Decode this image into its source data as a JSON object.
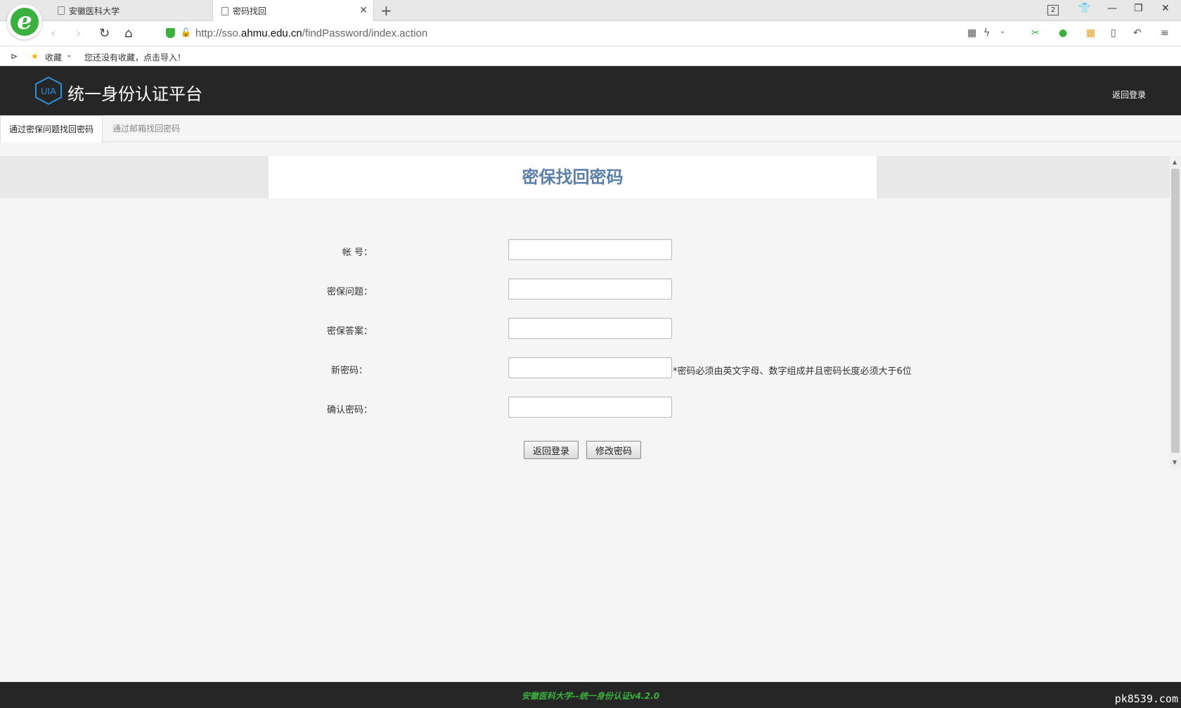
{
  "browser": {
    "tabs": [
      {
        "label": "安徽医科大学"
      },
      {
        "label": "密码找回"
      }
    ],
    "tab_count": "2",
    "url_prefix": "http://sso.",
    "url_domain": "ahmu.edu.cn",
    "url_path": "/findPassword/index.action",
    "bookmarks": {
      "favorites_label": "收藏",
      "empty_hint": "您还没有收藏，点击导入！"
    }
  },
  "header": {
    "logo_text": "UIA",
    "title": "统一身份认证平台",
    "back_login": "返回登录"
  },
  "page_tabs": [
    {
      "label": "通过密保问题找回密码",
      "active": true
    },
    {
      "label": "通过邮箱找回密码",
      "active": false
    }
  ],
  "form": {
    "heading": "密保找回密码",
    "fields": [
      {
        "label": "帐 号：",
        "value": ""
      },
      {
        "label": "密保问题：",
        "value": ""
      },
      {
        "label": "密保答案：",
        "value": ""
      },
      {
        "label": "新密码：",
        "value": "",
        "hint": "*密码必须由英文字母、数字组成并且密码长度必须大于6位"
      },
      {
        "label": "确认密码：",
        "value": ""
      }
    ],
    "buttons": {
      "back": "返回登录",
      "submit": "修改密码"
    }
  },
  "footer": {
    "text": "安徽医科大学--统一身份认证v4.2.0"
  },
  "watermark": "pk8539.com",
  "colors": {
    "header_bg": "#262626",
    "heading": "#5b7fa6",
    "footer_text": "#3ab13e",
    "logo_blue": "#2f8fd6"
  }
}
